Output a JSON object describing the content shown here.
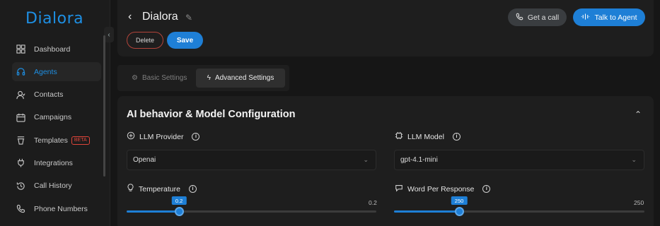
{
  "brand": {
    "logo_text": "Dialora"
  },
  "sidebar": {
    "items": [
      {
        "label": "Dashboard",
        "icon": "grid-icon"
      },
      {
        "label": "Agents",
        "icon": "headset-icon",
        "active": true
      },
      {
        "label": "Contacts",
        "icon": "user-icon"
      },
      {
        "label": "Campaigns",
        "icon": "calendar-icon"
      },
      {
        "label": "Templates",
        "icon": "template-icon",
        "badge": "BETA"
      },
      {
        "label": "Integrations",
        "icon": "plug-icon"
      },
      {
        "label": "Call History",
        "icon": "history-icon"
      },
      {
        "label": "Phone Numbers",
        "icon": "phone-icon"
      }
    ]
  },
  "header": {
    "title": "Dialora",
    "delete_label": "Delete",
    "save_label": "Save",
    "get_call_label": "Get a call",
    "talk_label": "Talk to Agent"
  },
  "tabs": {
    "basic": "Basic Settings",
    "advanced": "Advanced Settings"
  },
  "config": {
    "title": "AI behavior & Model Configuration",
    "llm_provider": {
      "label": "LLM Provider",
      "value": "Openai"
    },
    "llm_model": {
      "label": "LLM Model",
      "value": "gpt-4.1-mini"
    },
    "temperature": {
      "label": "Temperature",
      "value": "0.2",
      "max": "0.2",
      "fraction": 0.21
    },
    "word_per_response": {
      "label": "Word Per Response",
      "value": "250",
      "max": "250",
      "fraction": 0.26
    }
  },
  "colors": {
    "accent": "#1e7fd6",
    "danger": "#e0453a",
    "background": "#161616"
  }
}
